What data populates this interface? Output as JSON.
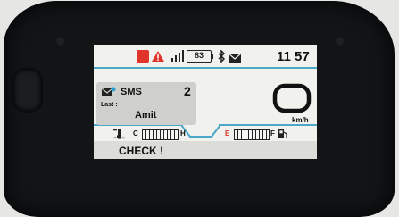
{
  "status_bar": {
    "clock": "11 57",
    "battery_level": "83",
    "icons": [
      "engine-warning-icon",
      "warning-triangle-icon",
      "signal-bars-icon",
      "battery-icon",
      "bluetooth-icon",
      "mail-icon"
    ]
  },
  "sms": {
    "title": "SMS",
    "count": "2",
    "last_label": "Last :",
    "last_sender": "Amit"
  },
  "speed": {
    "value": "0",
    "unit": "km/h"
  },
  "temperature_gauge": {
    "low": "C",
    "high": "H",
    "level": 0.3
  },
  "fuel_gauge": {
    "low": "E",
    "high": "F",
    "level": 0.25
  },
  "check_message": "CHECK !",
  "colors": {
    "accent_blue": "#4aa8c8",
    "warning_red": "#e0342a",
    "screen_bg": "#f1f1ee"
  }
}
